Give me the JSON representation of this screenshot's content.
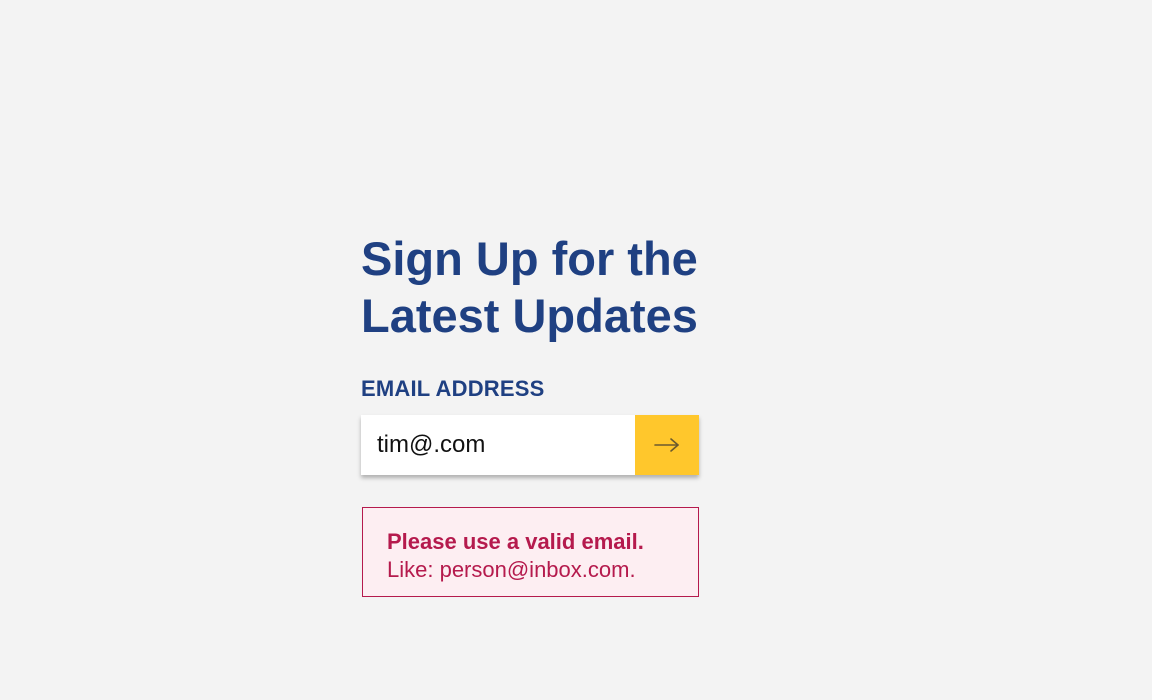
{
  "signup": {
    "title_line1": "Sign Up for the",
    "title_line2": "Latest Updates",
    "email_label": "EMAIL ADDRESS",
    "email_value": "tim@.com",
    "submit_icon": "arrow-right-icon"
  },
  "error": {
    "title": "Please use a valid email.",
    "hint": "Like: person@inbox.com."
  },
  "colors": {
    "background": "#f3f3f3",
    "heading": "#1f4082",
    "accent": "#ffc72c",
    "error_text": "#b51a4d",
    "error_background": "#fdeef2"
  }
}
